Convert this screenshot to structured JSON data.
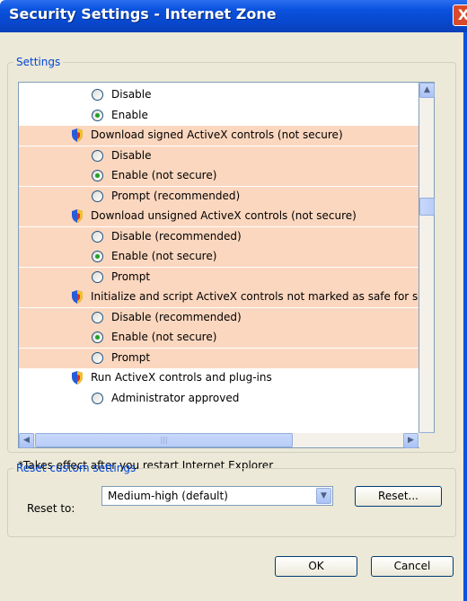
{
  "window": {
    "title": "Security Settings - Internet Zone",
    "close_glyph": "X"
  },
  "settings_group": {
    "legend": "Settings",
    "rows": [
      {
        "kind": "option",
        "label": "Disable",
        "checked": false,
        "highlight": false
      },
      {
        "kind": "option",
        "label": "Enable",
        "checked": true,
        "highlight": false
      },
      {
        "kind": "category",
        "label": "Download signed ActiveX controls (not secure)",
        "icon": "security-shield-icon",
        "highlight": true
      },
      {
        "kind": "option",
        "label": "Disable",
        "checked": false,
        "highlight": true
      },
      {
        "kind": "option",
        "label": "Enable (not secure)",
        "checked": true,
        "highlight": true
      },
      {
        "kind": "option",
        "label": "Prompt (recommended)",
        "checked": false,
        "highlight": true
      },
      {
        "kind": "category",
        "label": "Download unsigned ActiveX controls (not secure)",
        "icon": "security-shield-icon",
        "highlight": true
      },
      {
        "kind": "option",
        "label": "Disable (recommended)",
        "checked": false,
        "highlight": true
      },
      {
        "kind": "option",
        "label": "Enable (not secure)",
        "checked": true,
        "highlight": true
      },
      {
        "kind": "option",
        "label": "Prompt",
        "checked": false,
        "highlight": true
      },
      {
        "kind": "category",
        "label": "Initialize and script ActiveX controls not marked as safe for sc",
        "icon": "security-shield-icon",
        "highlight": true
      },
      {
        "kind": "option",
        "label": "Disable (recommended)",
        "checked": false,
        "highlight": true
      },
      {
        "kind": "option",
        "label": "Enable (not secure)",
        "checked": true,
        "highlight": true
      },
      {
        "kind": "option",
        "label": "Prompt",
        "checked": false,
        "highlight": true
      },
      {
        "kind": "category",
        "label": "Run ActiveX controls and plug-ins",
        "icon": "security-shield-icon",
        "highlight": false
      },
      {
        "kind": "option",
        "label": "Administrator approved",
        "checked": false,
        "highlight": false
      }
    ],
    "scroll": {
      "up_glyph": "▲",
      "down_glyph": "▼",
      "left_glyph": "◀",
      "right_glyph": "▶",
      "grip_glyph": "|||"
    },
    "footnote": "*Takes effect after you restart Internet Explorer"
  },
  "reset_group": {
    "legend": "Reset custom settings",
    "reset_to_label": "Reset to:",
    "reset_to_value": "Medium-high (default)",
    "dropdown_glyph": "▼",
    "reset_button": "Reset..."
  },
  "buttons": {
    "ok": "OK",
    "cancel": "Cancel"
  },
  "colors": {
    "highlight": "#fbd7bf",
    "title_bar": "#0a52de",
    "legend": "#0046d5",
    "radio_dot": "#21a121"
  }
}
